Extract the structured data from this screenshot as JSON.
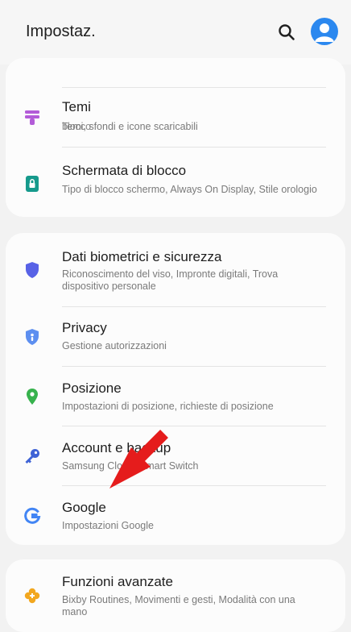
{
  "header": {
    "title": "Impostaz.",
    "search_icon": "search-icon",
    "profile_icon": "profile-avatar-icon",
    "accent": "#2b88ef"
  },
  "cards": [
    {
      "partial_text": "blocco",
      "items": [
        {
          "title": "Temi",
          "subtitle": "Temi, sfondi e icone scaricabili",
          "icon": "themes-brush-icon",
          "color": "#b35cd8"
        },
        {
          "title": "Schermata di blocco",
          "subtitle": "Tipo di blocco schermo, Always On Display, Stile orologio",
          "icon": "lock-screen-icon",
          "color": "#169a8c"
        }
      ]
    },
    {
      "items": [
        {
          "title": "Dati biometrici e sicurezza",
          "subtitle": "Riconoscimento del viso, Impronte digitali, Trova dispositivo personale",
          "icon": "shield-icon",
          "color": "#5862e6"
        },
        {
          "title": "Privacy",
          "subtitle": "Gestione autorizzazioni",
          "icon": "privacy-shield-icon",
          "color": "#5d8ff0"
        },
        {
          "title": "Posizione",
          "subtitle": "Impostazioni di posizione, richieste di posizione",
          "icon": "location-pin-icon",
          "color": "#37b24d"
        },
        {
          "title": "Account e backup",
          "subtitle": "Samsung Cloud, Smart Switch",
          "icon": "key-icon",
          "color": "#3f63d6"
        },
        {
          "title": "Google",
          "subtitle": "Impostazioni Google",
          "icon": "google-icon",
          "color": "#4285f4"
        }
      ]
    },
    {
      "items": [
        {
          "title": "Funzioni avanzate",
          "subtitle": "Bixby Routines, Movimenti e gesti, Modalità con una mano",
          "icon": "advanced-features-icon",
          "color": "#f2a71f"
        }
      ]
    }
  ],
  "annotation": {
    "icon": "red-arrow-pointer",
    "color": "#e51c1c"
  }
}
